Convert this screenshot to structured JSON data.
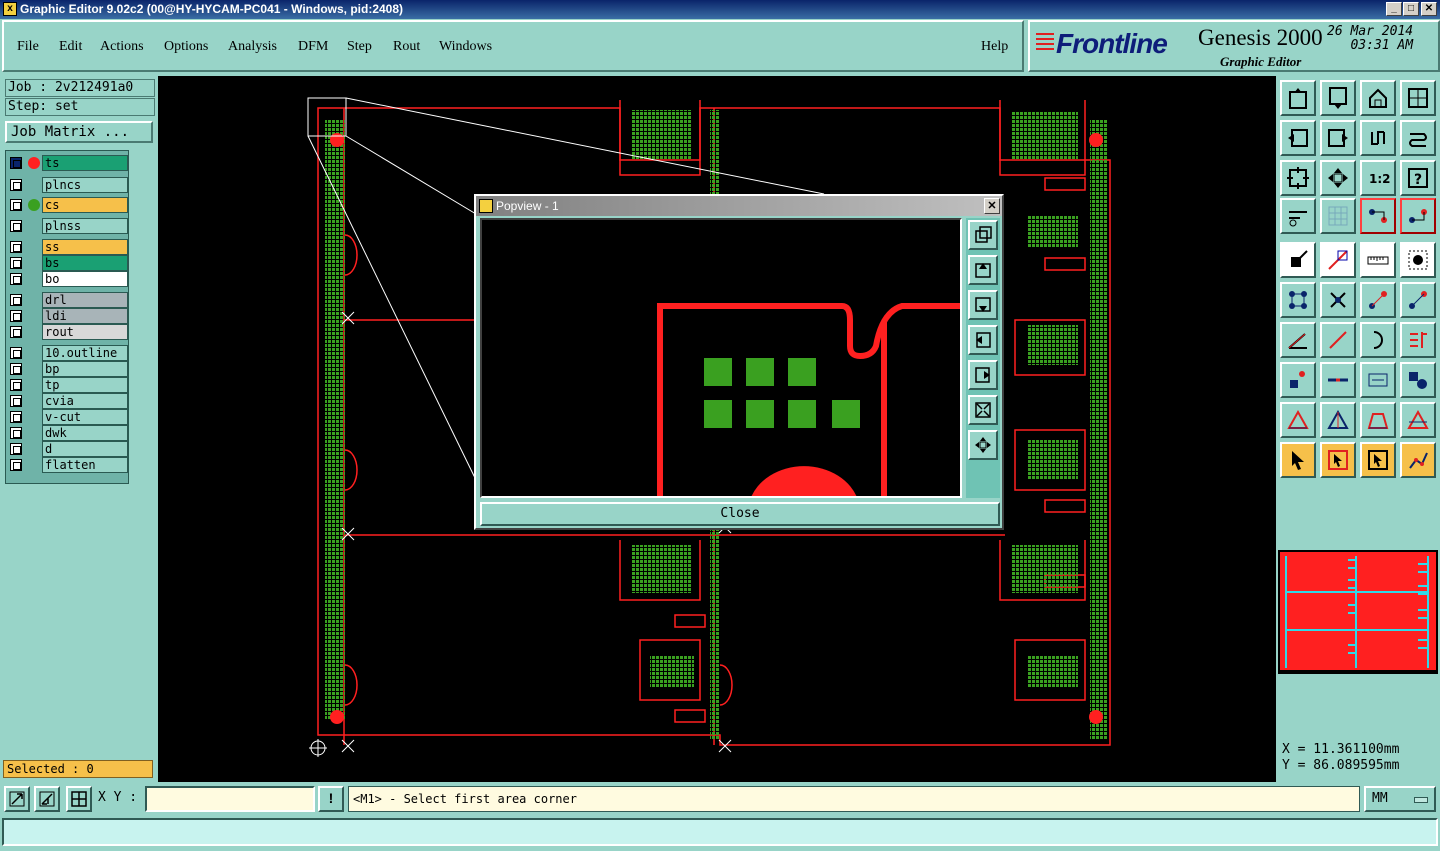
{
  "window": {
    "title": "Graphic Editor 9.02c2 (00@HY-HYCAM-PC041 - Windows, pid:2408)",
    "min": "_",
    "max": "□",
    "close": "✕"
  },
  "menu": {
    "items": [
      "File",
      "Edit",
      "Actions",
      "Options",
      "Analysis",
      "DFM",
      "Step",
      "Rout",
      "Windows"
    ],
    "help": "Help"
  },
  "brand": {
    "logo": "Frontline",
    "product": "Genesis 2000",
    "subtitle": "Graphic Editor",
    "date": "26 Mar 2014",
    "time": "03:31 AM"
  },
  "job": {
    "job_label": "Job : 2v212491a0",
    "step_label": "Step: set",
    "matrix_button": "Job Matrix ..."
  },
  "layers": [
    {
      "name": "ts",
      "color": "#1aa073",
      "dot": "#ff2020",
      "active": true
    },
    {
      "name": "plncs",
      "color": "#98d4c8",
      "dot": ""
    },
    {
      "name": "cs",
      "color": "#f6c04a",
      "dot": "#3aa020"
    },
    {
      "name": "plnss",
      "color": "#98d4c8",
      "dot": ""
    },
    {
      "name": "ss",
      "color": "#f6c04a",
      "dot": ""
    },
    {
      "name": "bs",
      "color": "#1aa073",
      "dot": ""
    },
    {
      "name": "bo",
      "color": "#ffffff",
      "dot": ""
    },
    {
      "name": "drl",
      "color": "#a8b4b8",
      "dot": ""
    },
    {
      "name": "ldi",
      "color": "#a8b4b8",
      "dot": ""
    },
    {
      "name": "rout",
      "color": "#d8d8d8",
      "dot": ""
    },
    {
      "name": "10.outline",
      "color": "#98d4c8",
      "dot": ""
    },
    {
      "name": "bp",
      "color": "#98d4c8",
      "dot": ""
    },
    {
      "name": "tp",
      "color": "#98d4c8",
      "dot": ""
    },
    {
      "name": "cvia",
      "color": "#98d4c8",
      "dot": ""
    },
    {
      "name": "v-cut",
      "color": "#98d4c8",
      "dot": ""
    },
    {
      "name": "dwk",
      "color": "#98d4c8",
      "dot": ""
    },
    {
      "name": "d",
      "color": "#98d4c8",
      "dot": ""
    },
    {
      "name": "flatten",
      "color": "#98d4c8",
      "dot": ""
    }
  ],
  "selected": "Selected : 0",
  "popview": {
    "title": "Popview - 1",
    "close_x": "✕",
    "close_button": "Close"
  },
  "coords": {
    "x": "X  =  11.361100mm",
    "y": "Y  =  86.089595mm"
  },
  "bottom": {
    "xy_label": "X Y :",
    "xy_value": "",
    "bang": "!",
    "prompt": "<M1> - Select first area corner",
    "units": "MM"
  },
  "colors": {
    "board_outline": "#ff2020",
    "pad_green": "#3aa020",
    "panel_teal": "#98d4c8"
  }
}
